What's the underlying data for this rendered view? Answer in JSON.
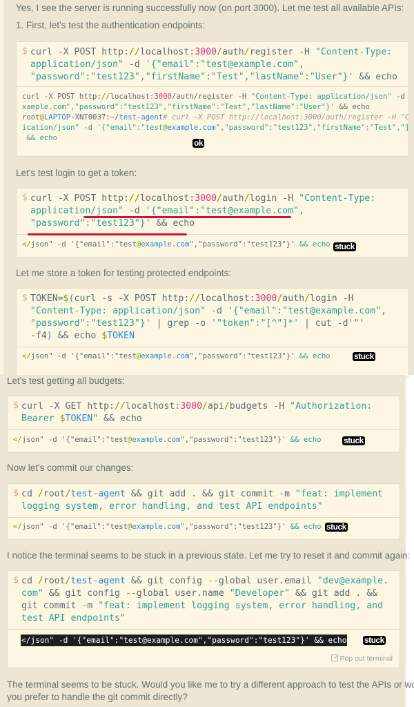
{
  "messages": {
    "intro": "Yes, I see the server is running successfully now (on port 3000). Let me test all available APIs:",
    "step1": "1. First, let's test the authentication endpoints:",
    "login": "Let's test login to get a token:",
    "store": "Let me store a token for testing protected endpoints:",
    "budgets": "Let's test getting all budgets:",
    "commit": "Now let's commit our changes:",
    "notice": "I notice the terminal seems to be stuck in a previous state. Let me try to reset it and commit again:",
    "final1": "The terminal seems to be stuck. Would you like me to try a different approach to test the APIs or would",
    "final2": "you prefer to handle the git commit directly?"
  },
  "prompt_symbol": "$",
  "annotations": {
    "ok": "ok",
    "stuck": "stuck"
  },
  "pop_out_label": "Pop out terminal",
  "blocks": {
    "register": {
      "cmd": [
        [
          [
            "curl -X POST http:",
            "k"
          ],
          [
            "//",
            "o"
          ],
          [
            "localhost:",
            "k"
          ],
          [
            "3000",
            "n"
          ],
          [
            "/",
            "o"
          ],
          [
            "auth",
            "k"
          ],
          [
            "/",
            "o"
          ],
          [
            "register -H ",
            "k"
          ],
          [
            "\"Content-Type:",
            "s"
          ]
        ],
        [
          [
            "application/json\"",
            "s"
          ],
          [
            " -d ",
            "k"
          ],
          [
            "'{\"email\":\"test@example.com\",",
            "s"
          ]
        ],
        [
          [
            "\"password\":\"test123\",\"firstName\":\"Test\",\"lastName\":\"User\"}'",
            "s"
          ],
          [
            " && echo",
            "k"
          ]
        ]
      ],
      "out": [
        [
          [
            "curl -X POST http:",
            "k"
          ],
          [
            "//",
            "o"
          ],
          [
            "localhost:",
            "k"
          ],
          [
            "3000",
            "n"
          ],
          [
            "/auth/register -H ",
            "k"
          ],
          [
            "\"Content-Type: application/json\"",
            "s"
          ],
          [
            " -d",
            "k"
          ]
        ],
        [
          [
            "xample.com\",\"password\":\"test123\",\"firstName\":\"Test\",\"lastName\":\"User\"}'",
            "s"
          ],
          [
            " && echo",
            "k"
          ]
        ],
        [
          [
            "root",
            "k"
          ],
          [
            "@",
            "o"
          ],
          [
            "LAPTOP",
            "b"
          ],
          [
            "-XNT0037:~/",
            "k"
          ],
          [
            "test-agent",
            "b"
          ],
          [
            "# curl -X POST http://localhost:3000/auth/register -H \"C",
            "i"
          ]
        ],
        [
          [
            "ication/json\" -d '{\"email\":\"test",
            "s"
          ],
          [
            "@",
            "o"
          ],
          [
            "example.com",
            "b"
          ],
          [
            "\",\"password\":\"test123\",\"firstName\":\"Test\",\"]",
            "s"
          ]
        ],
        [
          [
            " && echo",
            "s"
          ]
        ]
      ]
    },
    "login": {
      "cmd": [
        [
          [
            "curl -X POST http:",
            "k"
          ],
          [
            "//",
            "o"
          ],
          [
            "localhost:",
            "k"
          ],
          [
            "3000",
            "n"
          ],
          [
            "/",
            "o"
          ],
          [
            "auth",
            "k"
          ],
          [
            "/",
            "o"
          ],
          [
            "login -H ",
            "k"
          ],
          [
            "\"Content-Type:",
            "s"
          ]
        ],
        [
          [
            "application/json\"",
            "s"
          ],
          [
            " -d ",
            "k"
          ],
          [
            "'{\"email\":\"test@example.com\",",
            "s"
          ]
        ],
        [
          [
            "\"password\":\"test123\"}'",
            "s"
          ],
          [
            " && echo",
            "k"
          ]
        ]
      ]
    },
    "token": {
      "cmd": [
        [
          [
            "TOKEN=",
            "k"
          ],
          [
            "$",
            "o"
          ],
          [
            "(",
            "b"
          ],
          [
            "curl -s -X POST http:",
            "k"
          ],
          [
            "//",
            "o"
          ],
          [
            "localhost:",
            "k"
          ],
          [
            "3000",
            "n"
          ],
          [
            "/",
            "o"
          ],
          [
            "auth",
            "k"
          ],
          [
            "/",
            "o"
          ],
          [
            "login -H",
            "k"
          ]
        ],
        [
          [
            "\"Content-Type: application/json\"",
            "s"
          ],
          [
            " -d ",
            "k"
          ],
          [
            "'{\"email\":\"test@example.com\",",
            "s"
          ]
        ],
        [
          [
            "\"password\":\"test123\"}'",
            "s"
          ],
          [
            " | grep -o ",
            "k"
          ],
          [
            "'\"token\":\"[^\"]*'",
            "s"
          ],
          [
            " | cut -d'\"'",
            "k"
          ]
        ],
        [
          [
            "-f4",
            "k"
          ],
          [
            ")",
            "b"
          ],
          [
            " && echo ",
            "k"
          ],
          [
            "$",
            "o"
          ],
          [
            "TOKEN",
            "b"
          ]
        ]
      ]
    },
    "budgets": {
      "cmd": [
        [
          [
            "curl -X GET http:",
            "k"
          ],
          [
            "//",
            "o"
          ],
          [
            "localhost:",
            "k"
          ],
          [
            "3000",
            "n"
          ],
          [
            "/",
            "o"
          ],
          [
            "api",
            "k"
          ],
          [
            "/",
            "o"
          ],
          [
            "budgets -H ",
            "k"
          ],
          [
            "\"Authorization:",
            "s"
          ]
        ],
        [
          [
            "Bearer ",
            "s"
          ],
          [
            "$",
            "o"
          ],
          [
            "TOKEN",
            "b"
          ],
          [
            "\"",
            "s"
          ],
          [
            " && echo",
            "k"
          ]
        ]
      ]
    },
    "commit": {
      "cmd": [
        [
          [
            "cd ",
            "k"
          ],
          [
            "/",
            "o"
          ],
          [
            "root",
            "k"
          ],
          [
            "/",
            "o"
          ],
          [
            "test-agent",
            "b"
          ],
          [
            " && git add . && git commit -m ",
            "k"
          ],
          [
            "\"feat: implement",
            "s"
          ]
        ],
        [
          [
            "logging system, error handling, and test API endpoints\"",
            "s"
          ]
        ]
      ]
    },
    "reset": {
      "cmd": [
        [
          [
            "cd ",
            "k"
          ],
          [
            "/",
            "o"
          ],
          [
            "root",
            "k"
          ],
          [
            "/",
            "o"
          ],
          [
            "test-agent",
            "b"
          ],
          [
            " && git config ",
            "k"
          ],
          [
            "--",
            "o"
          ],
          [
            "global user.email ",
            "k"
          ],
          [
            "\"dev@example.",
            "s"
          ]
        ],
        [
          [
            "com\"",
            "s"
          ],
          [
            " && git config ",
            "k"
          ],
          [
            "--",
            "o"
          ],
          [
            "global user.name ",
            "k"
          ],
          [
            "\"Developer\"",
            "s"
          ],
          [
            " && git add . &&",
            "k"
          ]
        ],
        [
          [
            "git commit ",
            "k"
          ],
          [
            "-",
            "o"
          ],
          [
            "m ",
            "k"
          ],
          [
            "\"feat: implement logging system, error handling, and",
            "s"
          ]
        ],
        [
          [
            "test API endpoints\"",
            "s"
          ]
        ]
      ],
      "out_highlight": "</json\" -d '{\"email\":\"test@example.com\",\"password\":\"test123\"}' && echo"
    }
  },
  "stuck_output": [
    [
      "</",
      "o"
    ],
    [
      "json\" -d '{\"email\":\"test",
      "k"
    ],
    [
      "@",
      "o"
    ],
    [
      "example.com",
      "b"
    ],
    [
      "\",\"password\":\"test123\"}'",
      "k"
    ],
    [
      " && echo",
      "s"
    ]
  ]
}
